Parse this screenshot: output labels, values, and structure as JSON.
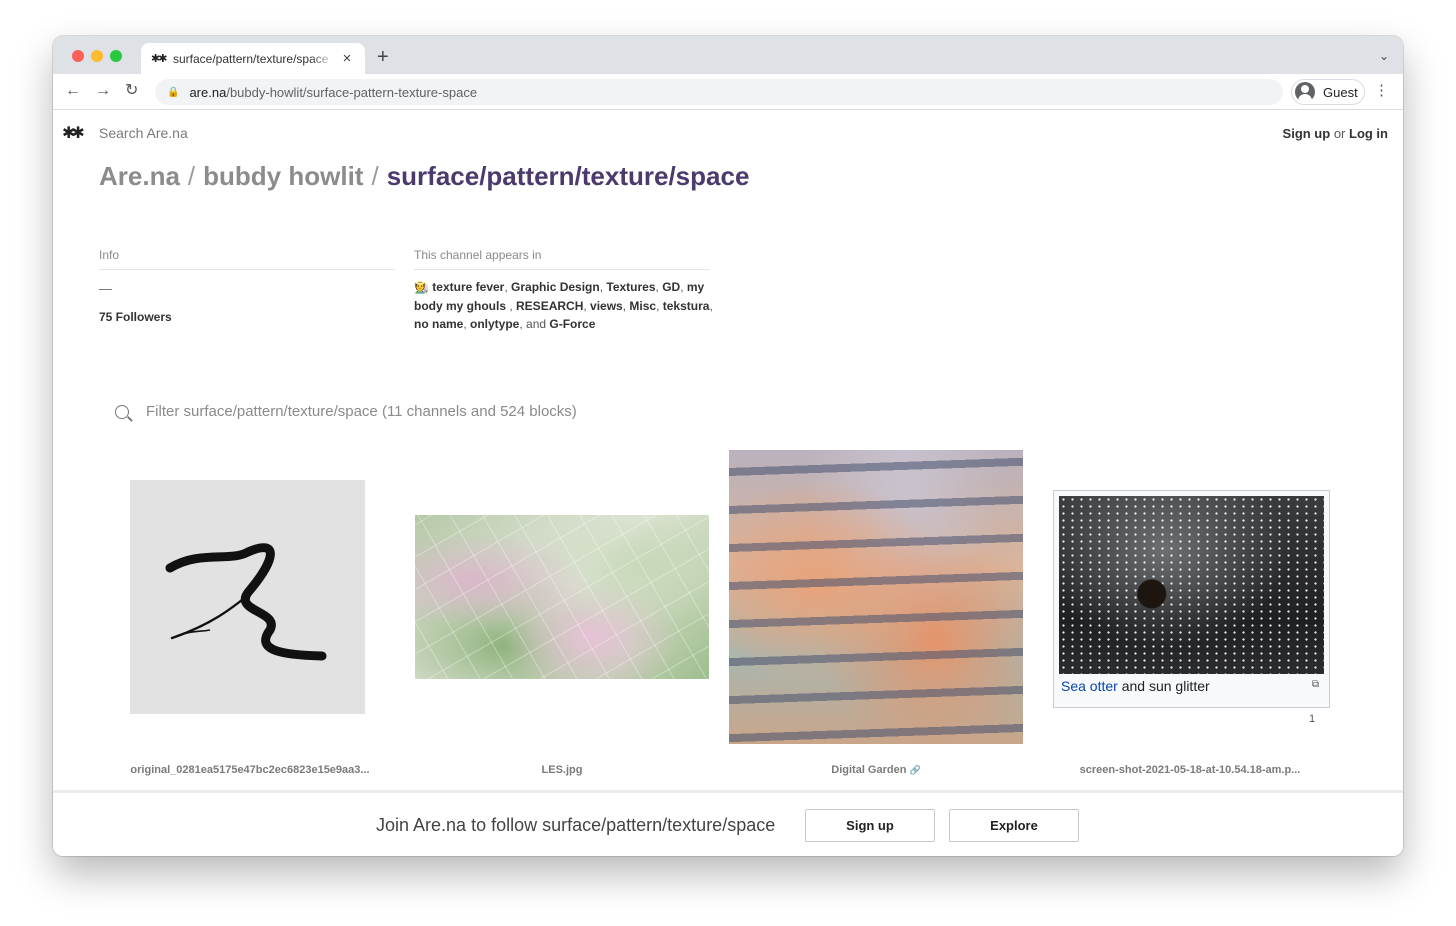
{
  "browser": {
    "tab_title": "surface/pattern/texture/space",
    "tab_favicon": "✱✱",
    "new_tab_label": "+",
    "url_host": "are.na",
    "url_path": "/bubdy-howlit/surface-pattern-texture-space",
    "profile_label": "Guest"
  },
  "header": {
    "logo": "✱✱",
    "search_placeholder": "Search Are.na",
    "sign_up": "Sign up",
    "or": " or ",
    "log_in": "Log in"
  },
  "breadcrumb": {
    "site": "Are.na",
    "sep": "/",
    "user": "bubdy howlit",
    "channel": "surface/pattern/texture/space"
  },
  "info": {
    "label": "Info",
    "description": "—",
    "followers": "75 Followers"
  },
  "appears_in": {
    "label": "This channel appears in",
    "emoji": "🧑‍🌾",
    "channels": [
      "texture fever",
      "Graphic Design",
      "Textures",
      "GD",
      "my body my ghouls ",
      "RESEARCH",
      "views",
      "Misc",
      "tekstura",
      "no name",
      "onlytype"
    ],
    "and": "and",
    "last": "G-Force"
  },
  "filter": {
    "placeholder": "Filter surface/pattern/texture/space (11 channels and 524 blocks)"
  },
  "blocks": [
    {
      "caption": "original_0281ea5175e47bc2ec6823e15e9aa3..."
    },
    {
      "caption": "LES.jpg"
    },
    {
      "caption": "Digital Garden",
      "link_icon": "🔗"
    },
    {
      "caption": "screen-shot-2021-05-18-at-10.54.18-am.p...",
      "embed_link": "Sea otter",
      "embed_text": " and sun glitter",
      "embed_count": "1"
    }
  ],
  "join": {
    "text": "Join Are.na to follow surface/pattern/texture/space",
    "sign_up": "Sign up",
    "explore": "Explore"
  },
  "colors": {
    "channel_accent": "#4b3a6b",
    "breadcrumb_grey": "#8c8c8c",
    "wiki_link": "#0645ad"
  }
}
